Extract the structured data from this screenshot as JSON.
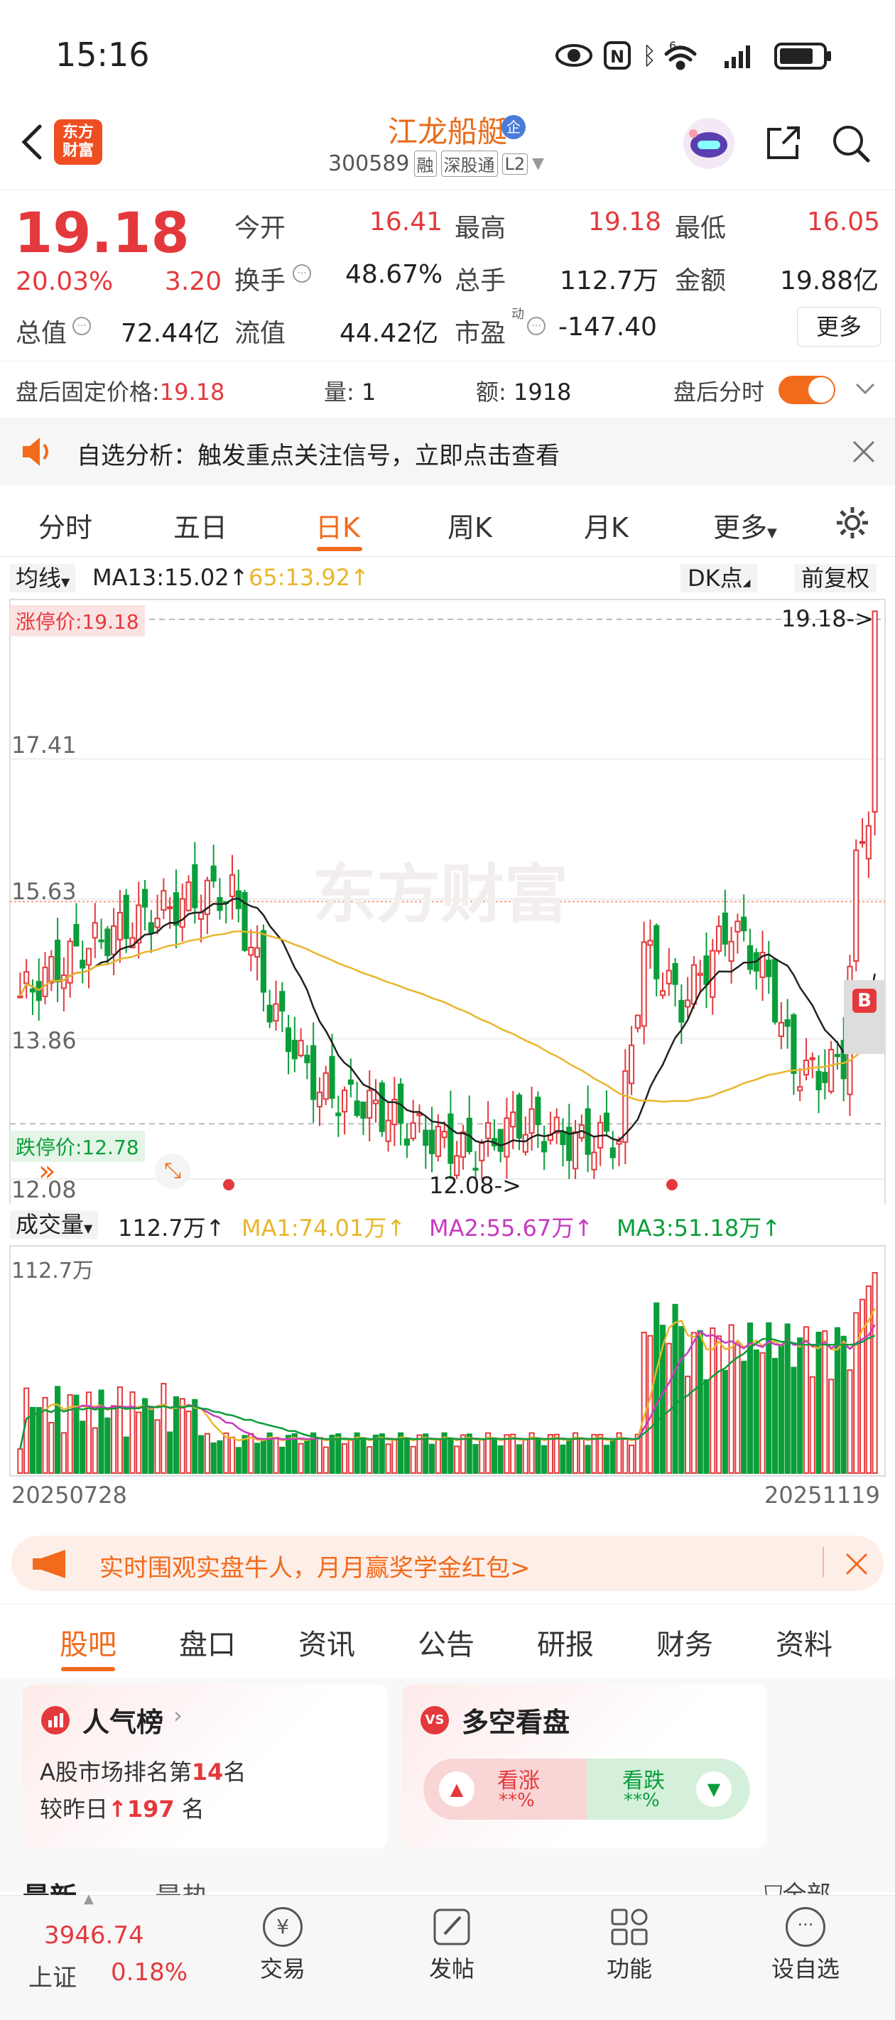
{
  "status": {
    "time": "15:16",
    "signal_label": "6"
  },
  "header": {
    "name": "江龙船艇",
    "code": "300589",
    "badges": [
      "融",
      "深股通",
      "L2"
    ],
    "brand": [
      "东方",
      "财富"
    ],
    "ent": "企"
  },
  "quote": {
    "price": "19.18",
    "pct": "20.03%",
    "change": "3.20",
    "rows": [
      [
        "今开",
        "16.41",
        "最高",
        "19.18",
        "最低",
        "16.05"
      ],
      [
        "换手",
        "48.67%",
        "总手",
        "112.7万",
        "金额",
        "19.88亿"
      ],
      [
        "总值",
        "72.44亿",
        "流值",
        "44.42亿",
        "市盈",
        "-147.40"
      ]
    ],
    "more": "更多",
    "pe_dyn": "动"
  },
  "after": {
    "fixed_label": "盘后固定价格:",
    "fixed_value": "19.18",
    "vol_label": "量:",
    "vol": "1",
    "amt_label": "额:",
    "amt": "1918",
    "fen_label": "盘后分时"
  },
  "notice": {
    "text": "自选分析：触发重点关注信号，立即点击查看"
  },
  "tabs": {
    "items": [
      "分时",
      "五日",
      "日K",
      "周K",
      "月K",
      "更多"
    ],
    "active": "日K"
  },
  "ma": {
    "type": "均线",
    "ma13": "MA13:15.02",
    "ma65": "65:13.92",
    "dk": "DK点",
    "fq": "前复权"
  },
  "kline": {
    "limit_up": "涨停价:19.18",
    "price_high": "19.18->",
    "limit_down": "跌停价:12.78",
    "price_low": "12.08->",
    "levels": [
      "17.41",
      "15.63",
      "13.86",
      "12.08"
    ],
    "b_label": "B"
  },
  "volume": {
    "type": "成交量",
    "vol": "112.7万",
    "ma1": "MA1:74.01万",
    "ma2": "MA2:55.67万",
    "ma3": "MA3:51.18万",
    "max": "112.7万",
    "start_date": "20250728",
    "end_date": "20251119"
  },
  "chart_data": [
    {
      "type": "candlestick",
      "title": "日K",
      "y_ticks": [
        12.08,
        13.86,
        15.63,
        17.41
      ],
      "ylim": [
        12.08,
        19.18
      ],
      "limit_up": 19.18,
      "limit_down": 12.78,
      "last_close": 19.18,
      "high": 19.18,
      "low": 12.08,
      "ma13": 15.02,
      "ma65": 13.92
    },
    {
      "type": "bar",
      "title": "成交量",
      "x_start": "20250728",
      "x_end": "20251119",
      "max": "112.7万",
      "last": "112.7万",
      "ma1": "74.01万",
      "ma2": "55.67万",
      "ma3": "51.18万"
    }
  ],
  "banner": {
    "text": "实时围观实盘牛人，月月赢奖学金红包>"
  },
  "bottom_tabs": {
    "items": [
      "股吧",
      "盘口",
      "资讯",
      "公告",
      "研报",
      "财务",
      "资料"
    ],
    "active": "股吧"
  },
  "cards": {
    "pop_title": "人气榜",
    "pop_line1_a": "A股市场排名第",
    "pop_rank": "14",
    "pop_line1_b": "名",
    "pop_line2_a": "较昨日",
    "pop_up": "197",
    "pop_line2_b": "名",
    "ls_title": "多空看盘",
    "bull": "看涨",
    "bull_pct": "**%",
    "bear": "看跌",
    "bear_pct": "**%"
  },
  "filter": {
    "latest": "最新",
    "hot": "最热",
    "all": "全部"
  },
  "nav": {
    "index_value": "3946.74",
    "index_name": "上证",
    "index_pct": "0.18%",
    "items": [
      "交易",
      "发帖",
      "功能",
      "设自选"
    ]
  }
}
